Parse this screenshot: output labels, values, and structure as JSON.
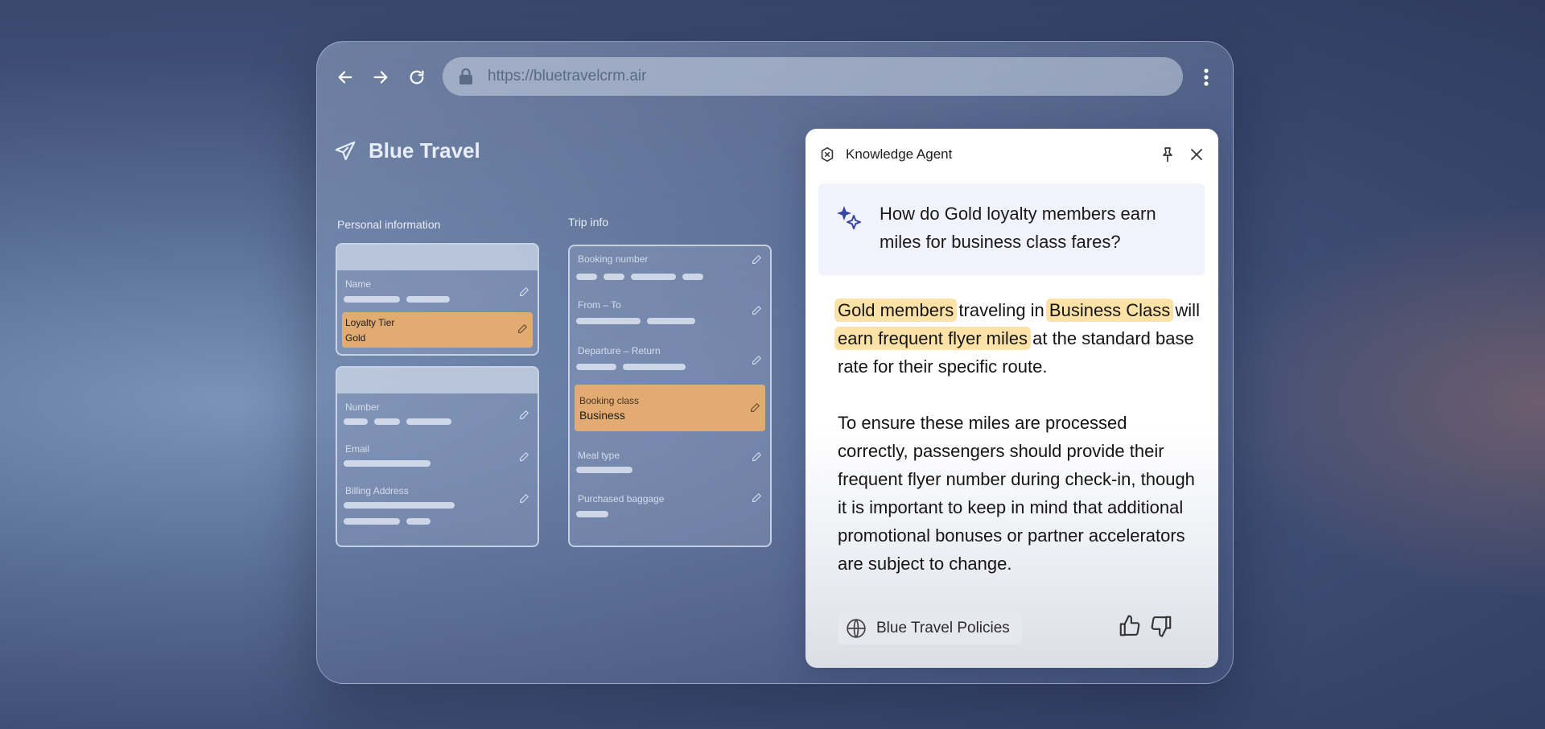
{
  "browser": {
    "url": "https://bluetravelcrm.air",
    "back_icon": "arrow-left-icon",
    "forward_icon": "arrow-right-icon",
    "reload_icon": "reload-icon",
    "menu_icon": "more-vertical-icon"
  },
  "brand": {
    "name": "Blue Travel",
    "icon": "airplane-icon"
  },
  "personal": {
    "title": "Personal information",
    "name_label": "Name",
    "loyalty_label": "Loyalty Tier",
    "loyalty_value": "Gold",
    "number_label": "Number",
    "email_label": "Email",
    "billing_label": "Billing Address"
  },
  "trip": {
    "title": "Trip info",
    "booking_number_label": "Booking number",
    "from_to_label": "From – To",
    "departure_label": "Departure – Return",
    "booking_class_label": "Booking class",
    "booking_class_value": "Business",
    "meal_label": "Meal type",
    "baggage_label": "Purchased baggage"
  },
  "agent": {
    "title": "Knowledge Agent",
    "question": "How do Gold loyalty members earn miles for business class fares?",
    "answer": {
      "p1_h1": "Gold members",
      "p1_t1": " traveling in ",
      "p1_h2": "Business Class",
      "p1_t2": " will ",
      "p1_h3": "earn frequent flyer miles",
      "p1_t3": " at the standard base rate for their specific route.",
      "p2": "To ensure these miles are processed correctly, passengers should provide their frequent flyer number during check-in, though it is important to keep in mind that additional promotional bonuses or partner accelerators are subject to change."
    },
    "source_label": "Blue Travel Policies"
  },
  "colors": {
    "highlight_field": "#e2ab72",
    "highlight_text": "#fde2a8",
    "question_bg": "#f1f2fb",
    "sparkle": "#3545a0"
  }
}
